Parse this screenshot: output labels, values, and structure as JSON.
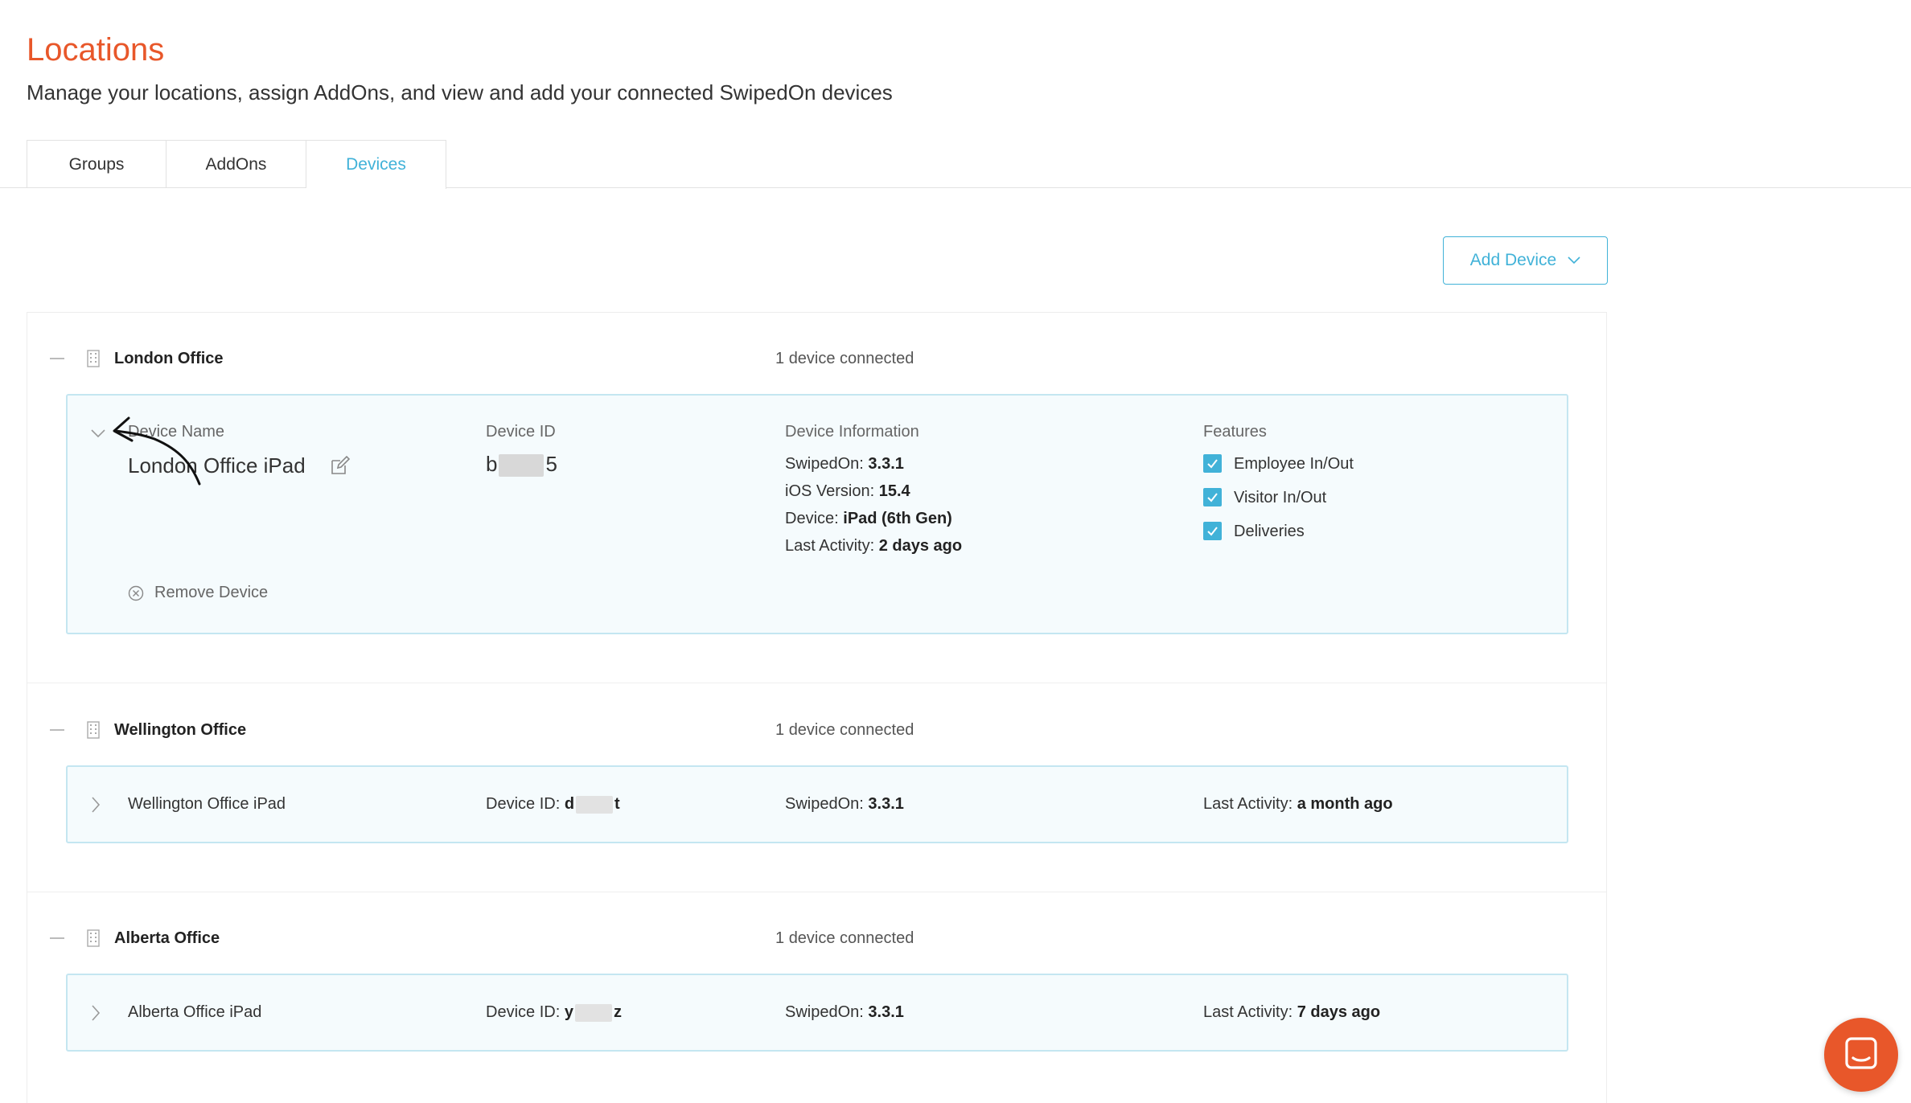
{
  "header": {
    "title": "Locations",
    "subtitle": "Manage your locations, assign AddOns, and view and add your connected SwipedOn devices"
  },
  "tabs": [
    {
      "label": "Groups",
      "active": false
    },
    {
      "label": "AddOns",
      "active": false
    },
    {
      "label": "Devices",
      "active": true
    }
  ],
  "toolbar": {
    "add_device_label": "Add Device"
  },
  "colors": {
    "brand": "#e8572a",
    "accent": "#41b2d8"
  },
  "groups": [
    {
      "name": "London Office",
      "count_num": "1",
      "count_text": "device connected",
      "device": {
        "expanded": true,
        "name_label": "Device Name",
        "name": "London Office iPad",
        "id_label": "Device ID",
        "id_start": "b",
        "id_end": "5",
        "info_label": "Device Information",
        "info": [
          {
            "label": "SwipedOn:",
            "value": "3.3.1"
          },
          {
            "label": "iOS Version:",
            "value": "15.4"
          },
          {
            "label": "Device:",
            "value": "iPad (6th Gen)"
          },
          {
            "label": "Last Activity:",
            "value": "2 days ago"
          }
        ],
        "features_label": "Features",
        "features": [
          {
            "label": "Employee In/Out",
            "checked": true
          },
          {
            "label": "Visitor In/Out",
            "checked": true
          },
          {
            "label": "Deliveries",
            "checked": true
          }
        ],
        "remove_label": "Remove Device"
      }
    },
    {
      "name": "Wellington Office",
      "count_num": "1",
      "count_text": "device connected",
      "device": {
        "expanded": false,
        "name": "Wellington Office iPad",
        "id_label": "Device ID:",
        "id_start": "d",
        "id_end": "t",
        "version_label": "SwipedOn:",
        "version": "3.3.1",
        "activity_label": "Last Activity:",
        "activity": "a month ago"
      }
    },
    {
      "name": "Alberta Office",
      "count_num": "1",
      "count_text": "device connected",
      "device": {
        "expanded": false,
        "name": "Alberta Office iPad",
        "id_label": "Device ID:",
        "id_start": "y",
        "id_end": "z",
        "version_label": "SwipedOn:",
        "version": "3.3.1",
        "activity_label": "Last Activity:",
        "activity": "7 days ago"
      }
    }
  ]
}
